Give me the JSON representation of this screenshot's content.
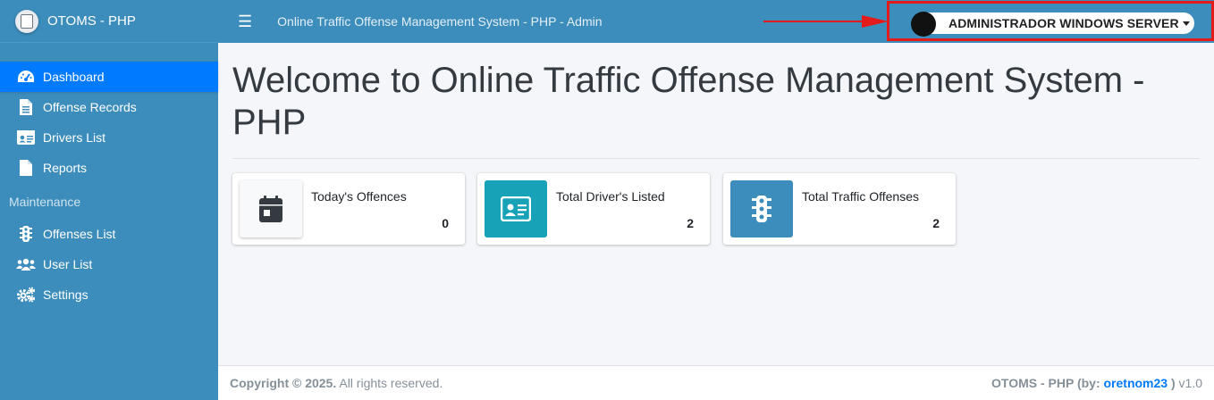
{
  "brand": {
    "name": "OTOMS - PHP"
  },
  "sidebar": {
    "items": [
      {
        "label": "Dashboard",
        "icon": "tachometer-icon",
        "active": true
      },
      {
        "label": "Offense Records",
        "icon": "file-text-icon"
      },
      {
        "label": "Drivers List",
        "icon": "id-card-icon"
      },
      {
        "label": "Reports",
        "icon": "file-icon"
      }
    ],
    "header": "Maintenance",
    "maintenance_items": [
      {
        "label": "Offenses List",
        "icon": "traffic-light-icon"
      },
      {
        "label": "User List",
        "icon": "users-icon"
      },
      {
        "label": "Settings",
        "icon": "cogs-icon"
      }
    ]
  },
  "topbar": {
    "title": "Online Traffic Offense Management System - PHP - Admin",
    "user_name": "ADMINISTRADOR WINDOWS SERVER",
    "annotation_color": "#e31b1b"
  },
  "main": {
    "welcome": "Welcome to Online Traffic Offense Management System - PHP",
    "cards": [
      {
        "label": "Today's Offences",
        "value": "0",
        "icon": "calendar-icon",
        "color": "#f8f9fa"
      },
      {
        "label": "Total Driver's Listed",
        "value": "2",
        "icon": "id-card-icon",
        "color": "#17a2b8"
      },
      {
        "label": "Total Traffic Offenses",
        "value": "2",
        "icon": "traffic-light-icon",
        "color": "#3c8dbc"
      }
    ]
  },
  "footer": {
    "copyright": "Copyright © 2025.",
    "rights": "All rights reserved.",
    "app": "OTOMS - PHP (by:",
    "author": "oretnom23",
    "close": ")",
    "version": "v1.0"
  },
  "colors": {
    "primary": "#3c8dbc",
    "active": "#007bff",
    "info": "#17a2b8"
  }
}
